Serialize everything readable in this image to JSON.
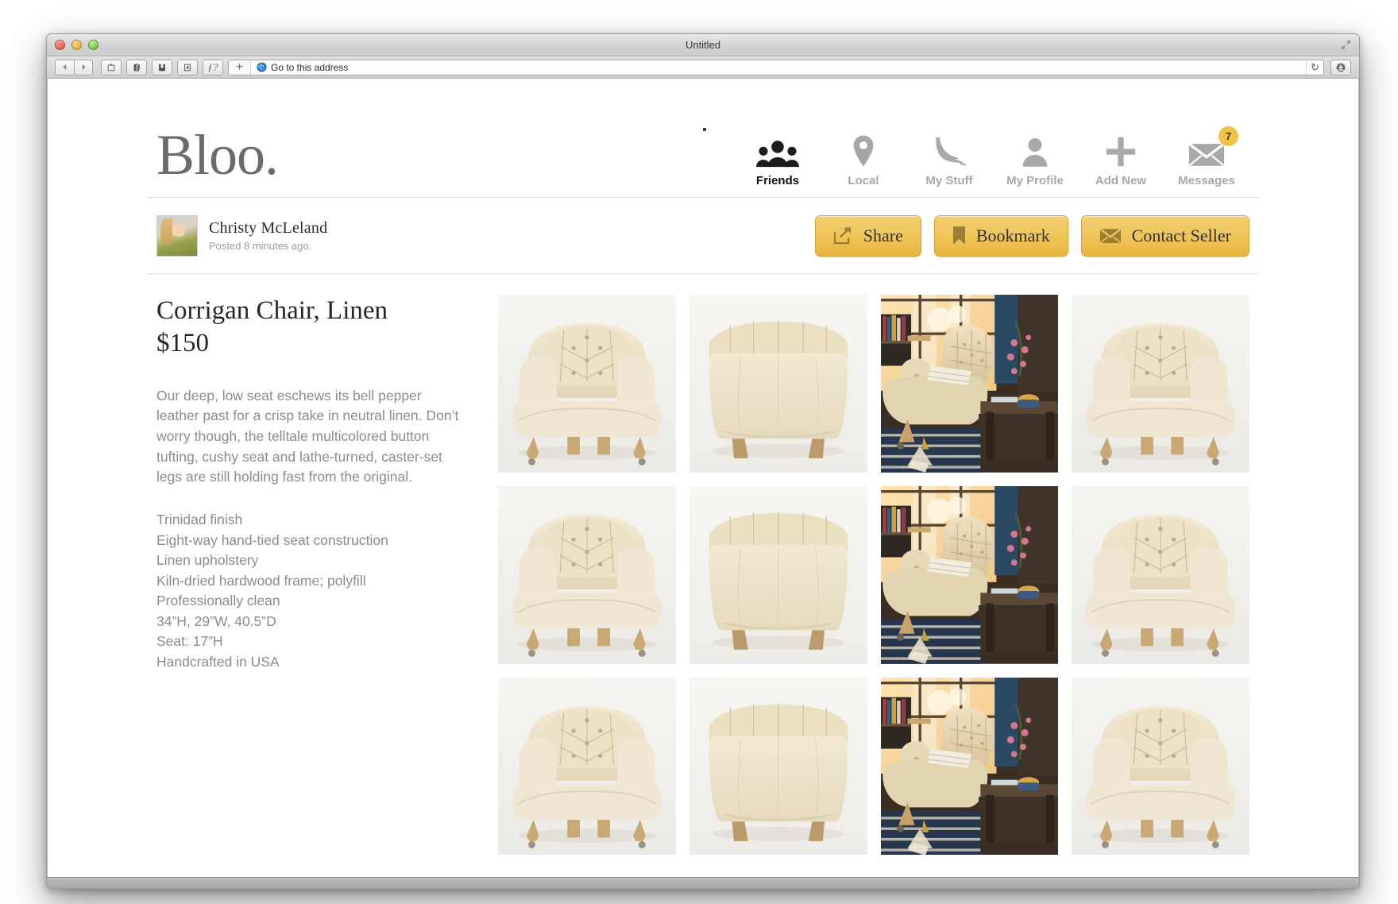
{
  "window": {
    "title": "Untitled",
    "controls": [
      "close",
      "minimize",
      "maximize"
    ]
  },
  "toolbar": {
    "back_label": "Back",
    "forward_label": "Forward",
    "home_label": "Home",
    "bookmarks_label": "Bookmarks",
    "reader_label": "Reader",
    "share_label": "Share",
    "script_label": "f?",
    "new_tab_label": "+",
    "address_placeholder": "Go to this address",
    "address_value": "Go to this address",
    "reload_label": "↻",
    "downloads_label": "Downloads"
  },
  "site": {
    "logo": "Bloo.",
    "nav": [
      {
        "label": "Friends",
        "icon": "friends-icon",
        "active": true,
        "badge": null
      },
      {
        "label": "Local",
        "icon": "location-pin-icon",
        "active": false,
        "badge": null
      },
      {
        "label": "My Stuff",
        "icon": "high-heel-icon",
        "active": false,
        "badge": null
      },
      {
        "label": "My Profile",
        "icon": "person-icon",
        "active": false,
        "badge": null
      },
      {
        "label": "Add New",
        "icon": "plus-icon",
        "active": false,
        "badge": null
      },
      {
        "label": "Messages",
        "icon": "envelope-icon",
        "active": false,
        "badge": "7"
      }
    ],
    "poster": {
      "avatar_alt": "christy-mcleland-avatar",
      "name": "Christy McLeland",
      "timestamp": "Posted 8 minutes ago."
    },
    "actions": [
      {
        "label": "Share",
        "icon": "share-arrow-icon"
      },
      {
        "label": "Bookmark",
        "icon": "bookmark-flag-icon"
      },
      {
        "label": "Contact Seller",
        "icon": "envelope-icon"
      }
    ],
    "accent_color": "#f0c24a",
    "product": {
      "title": "Corrigan Chair, Linen",
      "price": "$150",
      "description": "Our deep, low seat eschews its bell pepper leather past for a crisp take in neutral linen. Don’t worry though, the telltale multicolored button tufting, cushy seat and lathe-turned, caster-set legs are still holding fast from the original.",
      "specs": [
        "Trinidad finish",
        "Eight-way hand-tied seat construction",
        "Linen upholstery",
        "Kiln-dried hardwood frame; polyfill",
        "Professionally clean",
        "34”H, 29”W, 40.5”D",
        "Seat: 17”H",
        "Handcrafted in USA"
      ]
    },
    "gallery": [
      {
        "alt": "corrigan-chair-front-view",
        "variant": "front"
      },
      {
        "alt": "corrigan-chair-back-view",
        "variant": "back"
      },
      {
        "alt": "corrigan-chair-room-scene",
        "variant": "room"
      },
      {
        "alt": "corrigan-chair-front-view",
        "variant": "front"
      },
      {
        "alt": "corrigan-chair-front-view",
        "variant": "front"
      },
      {
        "alt": "corrigan-chair-back-view",
        "variant": "back"
      },
      {
        "alt": "corrigan-chair-room-scene",
        "variant": "room"
      },
      {
        "alt": "corrigan-chair-front-view",
        "variant": "front"
      },
      {
        "alt": "corrigan-chair-front-view",
        "variant": "front"
      },
      {
        "alt": "corrigan-chair-back-view",
        "variant": "back"
      },
      {
        "alt": "corrigan-chair-room-scene",
        "variant": "room"
      },
      {
        "alt": "corrigan-chair-front-view",
        "variant": "front"
      }
    ]
  }
}
